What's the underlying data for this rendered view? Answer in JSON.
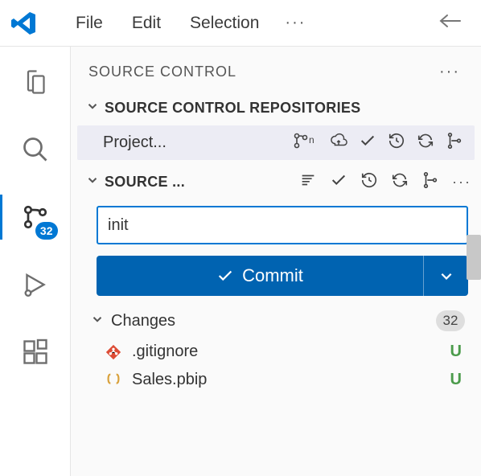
{
  "menubar": {
    "items": [
      "File",
      "Edit",
      "Selection"
    ],
    "more": "···"
  },
  "activitybar": {
    "scm_badge": "32"
  },
  "sidebar": {
    "title": "SOURCE CONTROL",
    "more": "···",
    "repos_label": "SOURCE CONTROL REPOSITORIES",
    "repo": {
      "name": "Project..."
    },
    "source_label": "SOURCE ...",
    "commit_input": "init",
    "commit_button": "Commit",
    "changes": {
      "label": "Changes",
      "count": "32",
      "files": [
        {
          "icon": "git",
          "name": ".gitignore",
          "status": "U"
        },
        {
          "icon": "json",
          "name": "Sales.pbip",
          "status": "U"
        }
      ]
    }
  },
  "colors": {
    "accent": "#0078d4",
    "button": "#0063b1",
    "untracked": "#4b9b4b"
  }
}
